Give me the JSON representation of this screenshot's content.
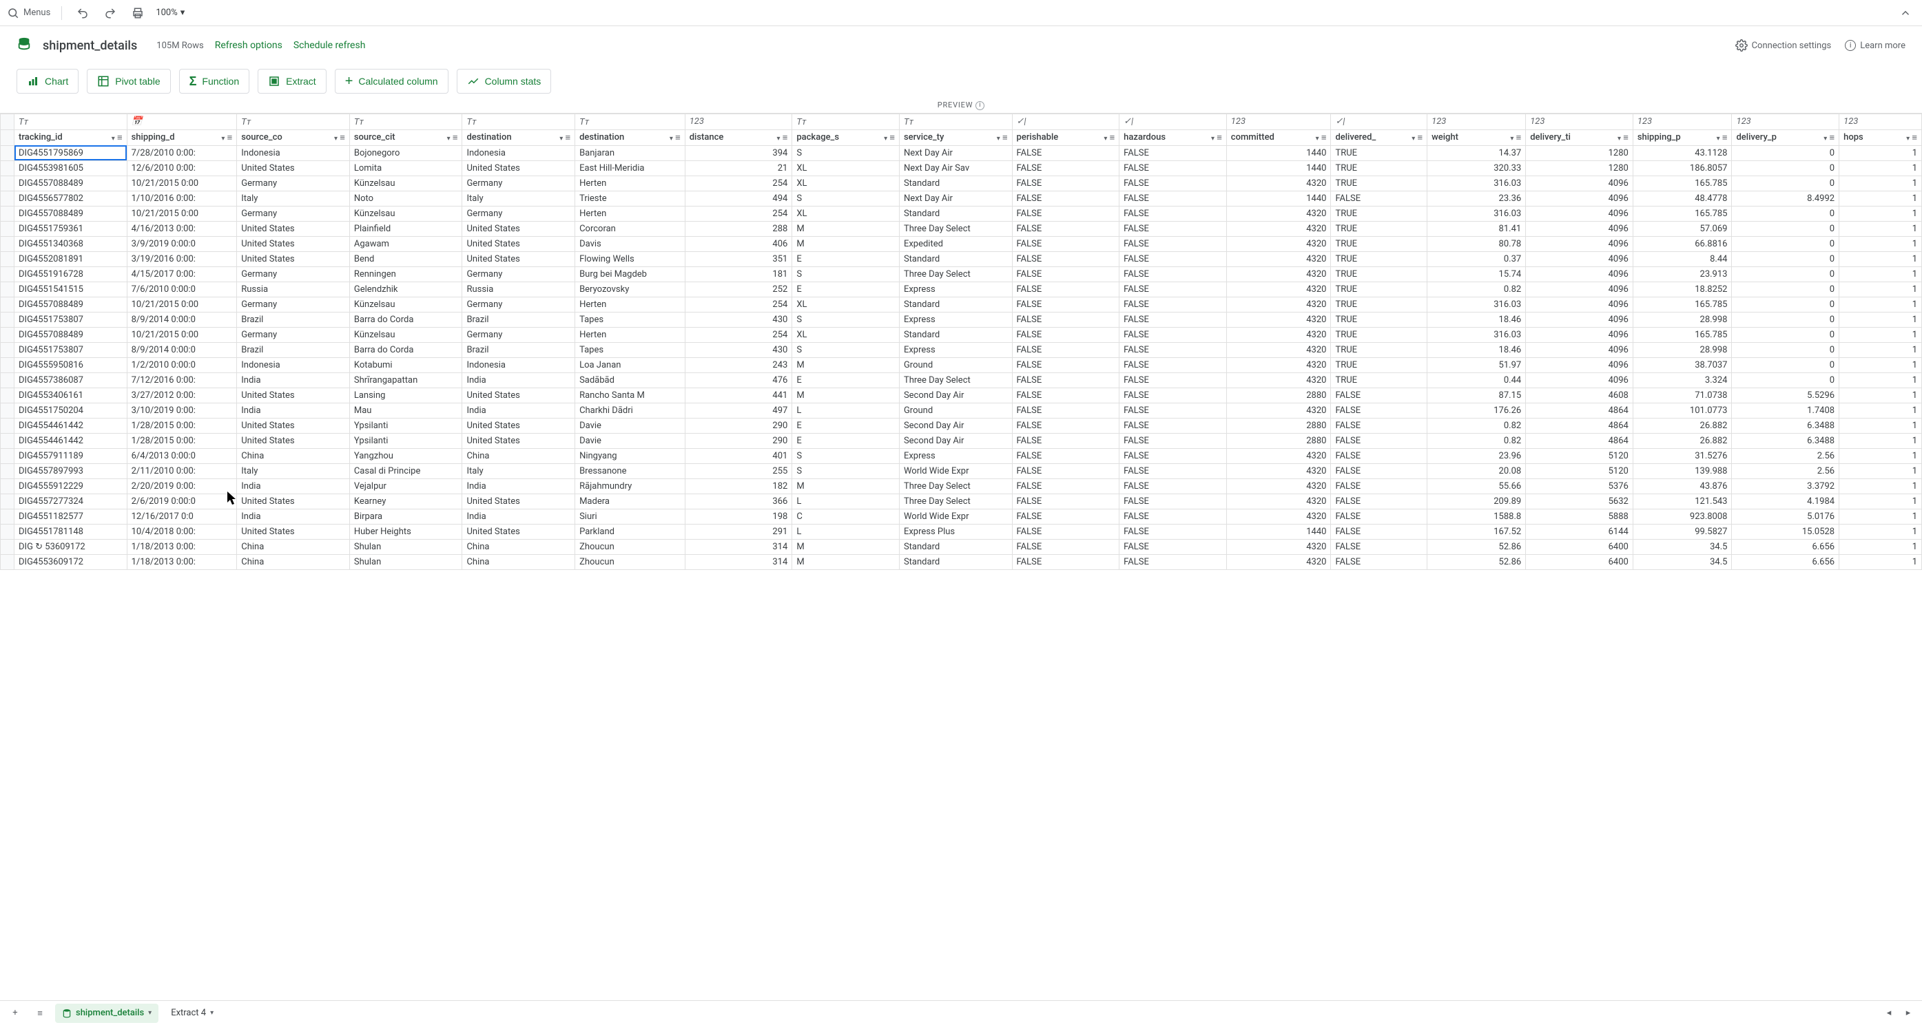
{
  "toolbar": {
    "menus_label": "Menus",
    "zoom": "100%"
  },
  "datasource": {
    "name": "shipment_details",
    "row_count": "105M Rows",
    "refresh_options": "Refresh options",
    "schedule": "Schedule refresh",
    "conn": "Connection settings",
    "learn": "Learn more"
  },
  "actions": {
    "chart": "Chart",
    "pivot": "Pivot table",
    "func": "Function",
    "extract": "Extract",
    "calc": "Calculated column",
    "stats": "Column stats"
  },
  "preview": "PREVIEW",
  "columns": {
    "types": [
      "Tᴛ",
      "📅",
      "Tᴛ",
      "Tᴛ",
      "Tᴛ",
      "Tᴛ",
      "123",
      "Tᴛ",
      "Tᴛ",
      "✓|",
      "✓|",
      "123",
      "✓|",
      "123",
      "123",
      "123",
      "123",
      "123"
    ],
    "names": [
      "tracking_id",
      "shipping_d",
      "source_co",
      "source_cit",
      "destination",
      "destination",
      "distance",
      "package_s",
      "service_ty",
      "perishable",
      "hazardous",
      "committed",
      "delivered_",
      "weight",
      "delivery_ti",
      "shipping_p",
      "delivery_p",
      "hops"
    ]
  },
  "rows": [
    [
      "DIG4551795869",
      "7/28/2010 0:00:",
      "Indonesia",
      "Bojonegoro",
      "Indonesia",
      "Banjaran",
      "394",
      "S",
      "Next Day Air",
      "FALSE",
      "FALSE",
      "1440",
      "TRUE",
      "14.37",
      "1280",
      "43.1128",
      "0",
      "1"
    ],
    [
      "DIG4553981605",
      "12/6/2010 0:00:",
      "United States",
      "Lomita",
      "United States",
      "East Hill-Meridia",
      "21",
      "XL",
      "Next Day Air Sav",
      "FALSE",
      "FALSE",
      "1440",
      "TRUE",
      "320.33",
      "1280",
      "186.8057",
      "0",
      "1"
    ],
    [
      "DIG4557088489",
      "10/21/2015 0:00",
      "Germany",
      "Künzelsau",
      "Germany",
      "Herten",
      "254",
      "XL",
      "Standard",
      "FALSE",
      "FALSE",
      "4320",
      "TRUE",
      "316.03",
      "4096",
      "165.785",
      "0",
      "1"
    ],
    [
      "DIG4556577802",
      "1/10/2016 0:00:",
      "Italy",
      "Noto",
      "Italy",
      "Trieste",
      "494",
      "S",
      "Next Day Air",
      "FALSE",
      "FALSE",
      "1440",
      "FALSE",
      "23.36",
      "4096",
      "48.4778",
      "8.4992",
      "1"
    ],
    [
      "DIG4557088489",
      "10/21/2015 0:00",
      "Germany",
      "Künzelsau",
      "Germany",
      "Herten",
      "254",
      "XL",
      "Standard",
      "FALSE",
      "FALSE",
      "4320",
      "TRUE",
      "316.03",
      "4096",
      "165.785",
      "0",
      "1"
    ],
    [
      "DIG4551759361",
      "4/16/2013 0:00:",
      "United States",
      "Plainfield",
      "United States",
      "Corcoran",
      "288",
      "M",
      "Three Day Select",
      "FALSE",
      "FALSE",
      "4320",
      "TRUE",
      "81.41",
      "4096",
      "57.069",
      "0",
      "1"
    ],
    [
      "DIG4551340368",
      "3/9/2019 0:00:0",
      "United States",
      "Agawam",
      "United States",
      "Davis",
      "406",
      "M",
      "Expedited",
      "FALSE",
      "FALSE",
      "4320",
      "TRUE",
      "80.78",
      "4096",
      "66.8816",
      "0",
      "1"
    ],
    [
      "DIG4552081891",
      "3/19/2016 0:00:",
      "United States",
      "Bend",
      "United States",
      "Flowing Wells",
      "351",
      "E",
      "Standard",
      "FALSE",
      "FALSE",
      "4320",
      "TRUE",
      "0.37",
      "4096",
      "8.44",
      "0",
      "1"
    ],
    [
      "DIG4551916728",
      "4/15/2017 0:00:",
      "Germany",
      "Renningen",
      "Germany",
      "Burg bei Magdeb",
      "181",
      "S",
      "Three Day Select",
      "FALSE",
      "FALSE",
      "4320",
      "TRUE",
      "15.74",
      "4096",
      "23.913",
      "0",
      "1"
    ],
    [
      "DIG4551541515",
      "7/6/2010 0:00:0",
      "Russia",
      "Gelendzhik",
      "Russia",
      "Beryozovsky",
      "252",
      "E",
      "Express",
      "FALSE",
      "FALSE",
      "4320",
      "TRUE",
      "0.82",
      "4096",
      "18.8252",
      "0",
      "1"
    ],
    [
      "DIG4557088489",
      "10/21/2015 0:00",
      "Germany",
      "Künzelsau",
      "Germany",
      "Herten",
      "254",
      "XL",
      "Standard",
      "FALSE",
      "FALSE",
      "4320",
      "TRUE",
      "316.03",
      "4096",
      "165.785",
      "0",
      "1"
    ],
    [
      "DIG4551753807",
      "8/9/2014 0:00:0",
      "Brazil",
      "Barra do Corda",
      "Brazil",
      "Tapes",
      "430",
      "S",
      "Express",
      "FALSE",
      "FALSE",
      "4320",
      "TRUE",
      "18.46",
      "4096",
      "28.998",
      "0",
      "1"
    ],
    [
      "DIG4557088489",
      "10/21/2015 0:00",
      "Germany",
      "Künzelsau",
      "Germany",
      "Herten",
      "254",
      "XL",
      "Standard",
      "FALSE",
      "FALSE",
      "4320",
      "TRUE",
      "316.03",
      "4096",
      "165.785",
      "0",
      "1"
    ],
    [
      "DIG4551753807",
      "8/9/2014 0:00:0",
      "Brazil",
      "Barra do Corda",
      "Brazil",
      "Tapes",
      "430",
      "S",
      "Express",
      "FALSE",
      "FALSE",
      "4320",
      "TRUE",
      "18.46",
      "4096",
      "28.998",
      "0",
      "1"
    ],
    [
      "DIG4555950816",
      "1/2/2010 0:00:0",
      "Indonesia",
      "Kotabumi",
      "Indonesia",
      "Loa Janan",
      "243",
      "M",
      "Ground",
      "FALSE",
      "FALSE",
      "4320",
      "TRUE",
      "51.97",
      "4096",
      "38.7037",
      "0",
      "1"
    ],
    [
      "DIG4557386087",
      "7/12/2016 0:00:",
      "India",
      "Shrīrangapattan",
      "India",
      "Sadābād",
      "476",
      "E",
      "Three Day Select",
      "FALSE",
      "FALSE",
      "4320",
      "TRUE",
      "0.44",
      "4096",
      "3.324",
      "0",
      "1"
    ],
    [
      "DIG4553406161",
      "3/27/2012 0:00:",
      "United States",
      "Lansing",
      "United States",
      "Rancho Santa M",
      "441",
      "M",
      "Second Day Air",
      "FALSE",
      "FALSE",
      "2880",
      "FALSE",
      "87.15",
      "4608",
      "71.0738",
      "5.5296",
      "1"
    ],
    [
      "DIG4551750204",
      "3/10/2019 0:00:",
      "India",
      "Mau",
      "India",
      "Charkhi Dādri",
      "497",
      "L",
      "Ground",
      "FALSE",
      "FALSE",
      "4320",
      "FALSE",
      "176.26",
      "4864",
      "101.0773",
      "1.7408",
      "1"
    ],
    [
      "DIG4554461442",
      "1/28/2015 0:00:",
      "United States",
      "Ypsilanti",
      "United States",
      "Davie",
      "290",
      "E",
      "Second Day Air",
      "FALSE",
      "FALSE",
      "2880",
      "FALSE",
      "0.82",
      "4864",
      "26.882",
      "6.3488",
      "1"
    ],
    [
      "DIG4554461442",
      "1/28/2015 0:00:",
      "United States",
      "Ypsilanti",
      "United States",
      "Davie",
      "290",
      "E",
      "Second Day Air",
      "FALSE",
      "FALSE",
      "2880",
      "FALSE",
      "0.82",
      "4864",
      "26.882",
      "6.3488",
      "1"
    ],
    [
      "DIG4557911189",
      "6/4/2013 0:00:0",
      "China",
      "Yangzhou",
      "China",
      "Ningyang",
      "401",
      "S",
      "Express",
      "FALSE",
      "FALSE",
      "4320",
      "FALSE",
      "23.96",
      "5120",
      "31.5276",
      "2.56",
      "1"
    ],
    [
      "DIG4557897993",
      "2/11/2010 0:00:",
      "Italy",
      "Casal di Principe",
      "Italy",
      "Bressanone",
      "255",
      "S",
      "World Wide Expr",
      "FALSE",
      "FALSE",
      "4320",
      "FALSE",
      "20.08",
      "5120",
      "139.988",
      "2.56",
      "1"
    ],
    [
      "DIG4555912229",
      "2/20/2019 0:00:",
      "India",
      "Vejalpur",
      "India",
      "Rājahmundry",
      "182",
      "M",
      "Three Day Select",
      "FALSE",
      "FALSE",
      "4320",
      "FALSE",
      "55.66",
      "5376",
      "43.876",
      "3.3792",
      "1"
    ],
    [
      "DIG4557277324",
      "2/6/2019 0:00:0",
      "United States",
      "Kearney",
      "United States",
      "Madera",
      "366",
      "L",
      "Three Day Select",
      "FALSE",
      "FALSE",
      "4320",
      "FALSE",
      "209.89",
      "5632",
      "121.543",
      "4.1984",
      "1"
    ],
    [
      "DIG4551182577",
      "12/16/2017 0:0",
      "India",
      "Birpara",
      "India",
      "Siuri",
      "198",
      "C",
      "World Wide Expr",
      "FALSE",
      "FALSE",
      "4320",
      "FALSE",
      "1588.8",
      "5888",
      "923.8008",
      "5.0176",
      "1"
    ],
    [
      "DIG4551781148",
      "10/4/2018 0:00:",
      "United States",
      "Huber Heights",
      "United States",
      "Parkland",
      "291",
      "L",
      "Express Plus",
      "FALSE",
      "FALSE",
      "1440",
      "FALSE",
      "167.52",
      "6144",
      "99.5827",
      "15.0528",
      "1"
    ],
    [
      "DIG ↻ 53609172",
      "1/18/2013 0:00:",
      "China",
      "Shulan",
      "China",
      "Zhoucun",
      "314",
      "M",
      "Standard",
      "FALSE",
      "FALSE",
      "4320",
      "FALSE",
      "52.86",
      "6400",
      "34.5",
      "6.656",
      "1"
    ],
    [
      "DIG4553609172",
      "1/18/2013 0:00:",
      "China",
      "Shulan",
      "China",
      "Zhoucun",
      "314",
      "M",
      "Standard",
      "FALSE",
      "FALSE",
      "4320",
      "FALSE",
      "52.86",
      "6400",
      "34.5",
      "6.656",
      "1"
    ]
  ],
  "tabs": {
    "active": "shipment_details",
    "second": "Extract 4"
  },
  "numeric_cols": [
    6,
    11,
    13,
    14,
    15,
    16,
    17
  ]
}
